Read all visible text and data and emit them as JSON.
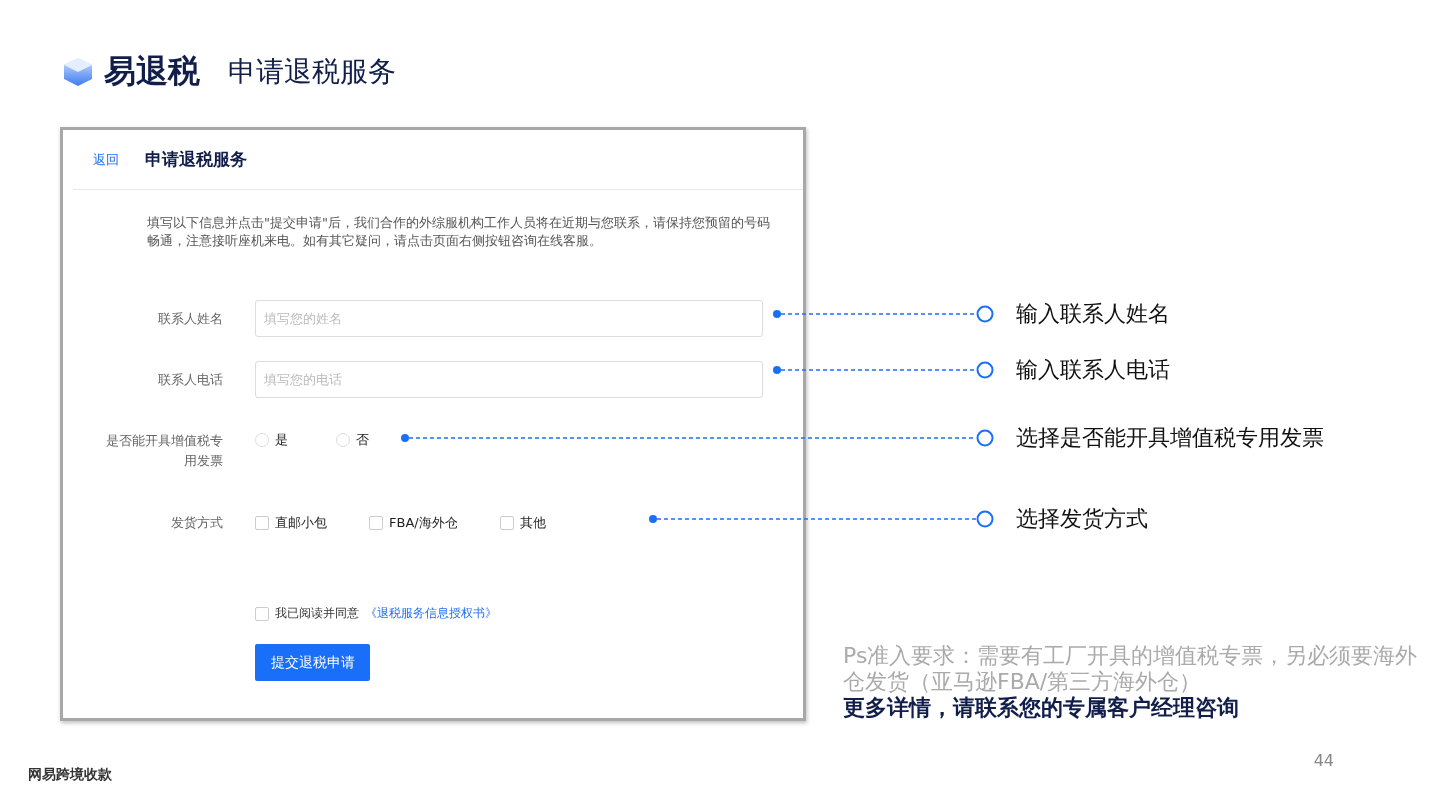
{
  "header": {
    "brand": "易退税",
    "title": "申请退税服务"
  },
  "form": {
    "back_link": "返回",
    "title": "申请退税服务",
    "intro": "填写以下信息并点击\"提交申请\"后，我们合作的外综服机构工作人员将在近期与您联系，请保持您预留的号码畅通，注意接听座机来电。如有其它疑问，请点击页面右侧按钮咨询在线客服。",
    "fields": [
      {
        "label": "联系人姓名",
        "placeholder": "填写您的姓名"
      },
      {
        "label": "联系人电话",
        "placeholder": "填写您的电话"
      }
    ],
    "invoice": {
      "label": "是否能开具增值税专用发票",
      "options": [
        {
          "label": "是",
          "selected": false
        },
        {
          "label": "否",
          "selected": false
        }
      ]
    },
    "shipping": {
      "label": "发货方式",
      "options": [
        {
          "label": "直邮小包",
          "checked": false
        },
        {
          "label": "FBA/海外仓",
          "checked": false
        },
        {
          "label": "其他",
          "checked": false
        }
      ]
    },
    "agreement": {
      "text": "我已阅读并同意",
      "link": "《退税服务信息授权书》",
      "checked": false
    },
    "submit": "提交退税申请"
  },
  "callouts": [
    {
      "text": "输入联系人姓名"
    },
    {
      "text": "输入联系人电话"
    },
    {
      "text": "选择是否能开具增值税专用发票"
    },
    {
      "text": "选择发货方式"
    }
  ],
  "note": {
    "text": "Ps准入要求：需要有工厂开具的增值税专票，另必须要海外仓发货（亚马逊FBA/第三方海外仓）",
    "emphasis": "更多详情，请联系您的专属客户经理咨询"
  },
  "footer": {
    "brand": "网易跨境收款",
    "page": "44"
  }
}
